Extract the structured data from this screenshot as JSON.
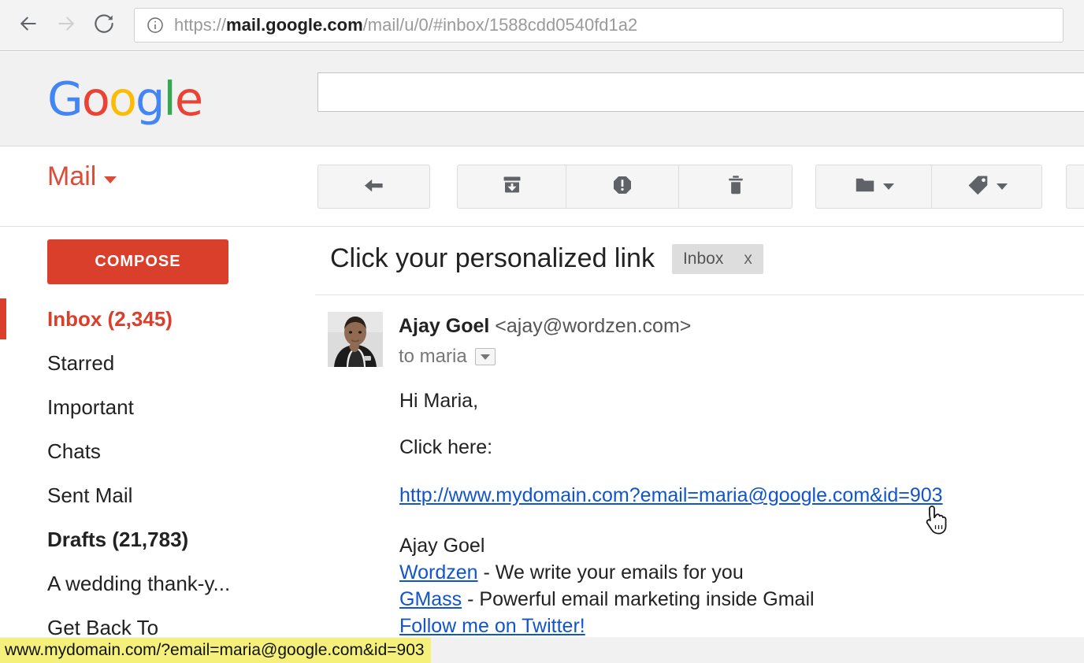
{
  "browser": {
    "back_icon": "back-arrow-icon",
    "forward_icon": "forward-arrow-icon",
    "reload_icon": "reload-icon",
    "info_icon": "info-circle-icon",
    "url_scheme": "https://",
    "url_host": "mail.google.com",
    "url_path": "/mail/u/0/#inbox/1588cdd0540fd1a2",
    "url_full": "https://mail.google.com/mail/u/0/#inbox/1588cdd0540fd1a2"
  },
  "header": {
    "logo_letters": [
      "G",
      "o",
      "o",
      "g",
      "l",
      "e"
    ],
    "search_value": "",
    "search_placeholder": ""
  },
  "toolbar": {
    "app_label": "Mail",
    "buttons": [
      {
        "name": "reply-button",
        "icon": "reply-arrow-icon",
        "has_caret": false
      },
      {
        "name": "archive-button",
        "icon": "archive-box-icon",
        "has_caret": false
      },
      {
        "name": "report-spam-button",
        "icon": "spam-octagon-icon",
        "has_caret": false
      },
      {
        "name": "delete-button",
        "icon": "trash-icon",
        "has_caret": false
      },
      {
        "name": "move-to-button",
        "icon": "folder-icon",
        "has_caret": true
      },
      {
        "name": "labels-button",
        "icon": "tag-icon",
        "has_caret": true
      }
    ]
  },
  "sidebar": {
    "compose_label": "COMPOSE",
    "items": [
      {
        "label": "Inbox (2,345)",
        "active": true,
        "bold": true
      },
      {
        "label": "Starred",
        "active": false,
        "bold": false
      },
      {
        "label": "Important",
        "active": false,
        "bold": false
      },
      {
        "label": "Chats",
        "active": false,
        "bold": false
      },
      {
        "label": "Sent Mail",
        "active": false,
        "bold": false
      },
      {
        "label": "Drafts (21,783)",
        "active": false,
        "bold": true
      },
      {
        "label": "A wedding thank-y...",
        "active": false,
        "bold": false
      },
      {
        "label": "Get Back To",
        "active": false,
        "bold": false
      }
    ]
  },
  "email": {
    "subject": "Click your personalized link",
    "label_chip": "Inbox",
    "label_chip_remove": "x",
    "sender_name": "Ajay Goel",
    "sender_address": "<ajay@wordzen.com>",
    "recipient": "to maria",
    "greeting": "Hi Maria,",
    "instruction": "Click here:",
    "primary_link": "http://www.mydomain.com?email=maria@google.com&id=903",
    "signature": {
      "name": "Ajay Goel",
      "line2_link": "Wordzen",
      "line2_rest": " - We write your emails for you",
      "line3_link": "GMass",
      "line3_rest": " - Powerful email marketing inside Gmail",
      "line4_link": "Follow me on Twitter!"
    }
  },
  "status_bar": {
    "url": "www.mydomain.com/?email=maria@google.com&id=903"
  },
  "cursor": {
    "type": "pointing-hand-cursor"
  },
  "colors": {
    "brand_red": "#d93f2b",
    "link_blue": "#1155cc",
    "status_highlight": "#f4f07a",
    "google_blue": "#4285f4",
    "google_red": "#ea4335",
    "google_yellow": "#fbbc05",
    "google_green": "#34a853"
  }
}
